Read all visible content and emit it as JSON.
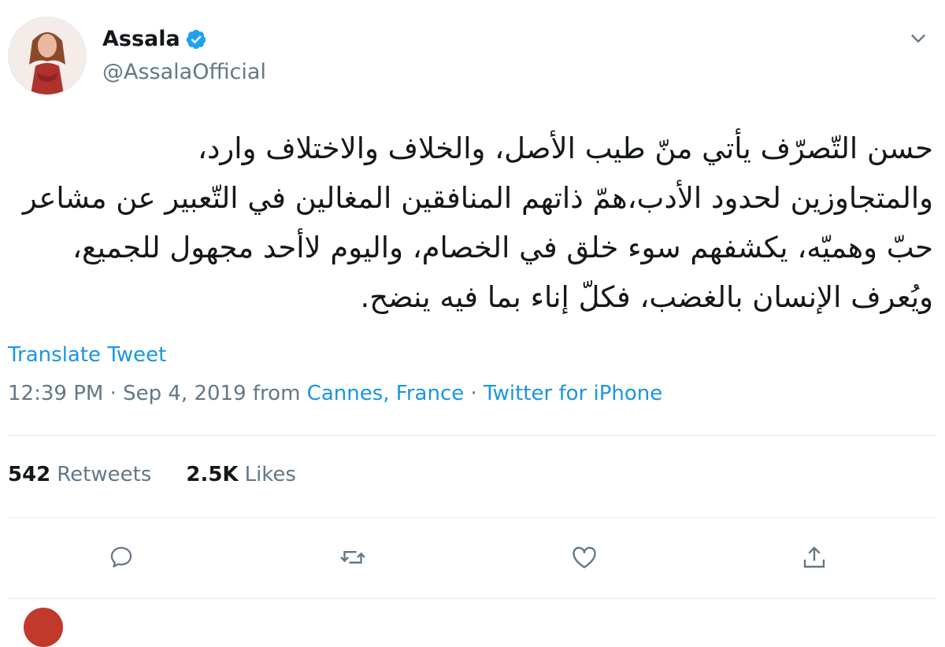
{
  "user": {
    "display_name": "Assala",
    "handle": "@AssalaOfficial",
    "verified": true
  },
  "tweet": {
    "lines": [
      "حسن التّصرّف يأتي منّ طيب الأصل، والخلاف والاختلاف وارد،",
      "والمتجاوزين لحدود الأدب،همّ ذاتهم المنافقين المغالين في التّعبير عن مشاعر",
      "حبّ وهميّه، يكشفهم سوء خلق في الخصام، واليوم لاأحد مجهول للجميع،",
      "ويُعرف الإنسان بالغضب، فكلّ إناء بما فيه ينضح."
    ],
    "translate_label": "Translate Tweet",
    "time": "12:39 PM",
    "date": "Sep 4, 2019",
    "from_label": "from",
    "location": "Cannes, France",
    "source": "Twitter for iPhone"
  },
  "stats": {
    "retweets_count": "542",
    "retweets_label": "Retweets",
    "likes_count": "2.5K",
    "likes_label": "Likes"
  },
  "actions": {
    "icons": [
      "reply-icon",
      "retweet-icon",
      "like-icon",
      "share-icon"
    ]
  },
  "colors": {
    "accent": "#1b95e0",
    "verified": "#1da1f2",
    "muted": "#657786",
    "text": "#14171a",
    "divider": "#e6ecf0"
  }
}
